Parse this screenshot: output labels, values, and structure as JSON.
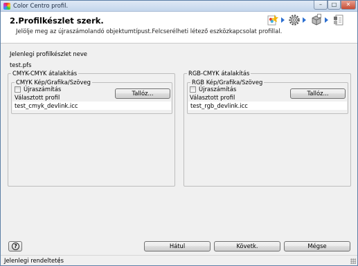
{
  "window": {
    "title": "Color Centro profil.",
    "minimize": "–",
    "maximize": "□",
    "close": "✕"
  },
  "header": {
    "title": "2.Profilkészlet szerk.",
    "description": "Jelölje meg az újraszámolandó objektumtípust.Felcserélheti létező eszközkapcsolat profillal."
  },
  "profile_set": {
    "label": "Jelenlegi profilkészlet neve",
    "value": "test.pfs"
  },
  "cmyk_group": {
    "title": "CMYK-CMYK átalakítás",
    "sub_title": "CMYK Kép/Grafika/Szöveg",
    "recalc_label": "Újraszámítás",
    "recalc_checked": false,
    "browse_label": "Tallóz...",
    "selected_label": "Választott profil",
    "selected_value": "test_cmyk_devlink.icc"
  },
  "rgb_group": {
    "title": "RGB-CMYK átalakítás",
    "sub_title": "RGB Kép/Grafika/Szöveg",
    "recalc_label": "Újraszámítás",
    "recalc_checked": false,
    "browse_label": "Tallóz...",
    "selected_label": "Választott profil",
    "selected_value": "test_rgb_devlink.icc"
  },
  "footer": {
    "help": "?",
    "back_label": "Hátul",
    "next_label": "Követk.",
    "cancel_label": "Mégse"
  },
  "status": {
    "text": "Jelenlegi rendeltetés"
  },
  "icons": [
    "app-icon",
    "step-color-icon",
    "step-gear-icon",
    "step-box-icon",
    "step-document-icon",
    "help-icon"
  ]
}
